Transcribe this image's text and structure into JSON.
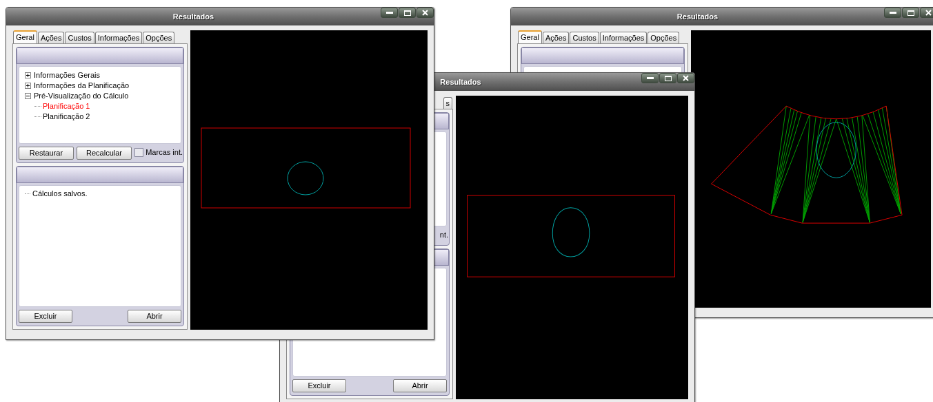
{
  "windows": [
    {
      "title": "Resultados",
      "tabs": [
        {
          "label": "Geral",
          "selected": true
        },
        {
          "label": "Ações",
          "selected": false
        },
        {
          "label": "Custos",
          "selected": false
        },
        {
          "label": "Informações",
          "selected": false
        },
        {
          "label": "Opções",
          "selected": false
        }
      ],
      "preview": {
        "kind": "fan"
      }
    },
    {
      "title": "Resultados",
      "tabs": [
        {
          "label": "s",
          "selected": false
        }
      ],
      "checkbox": {
        "label": "nt."
      },
      "list_buttons": [
        "Excluir",
        "Abrir"
      ],
      "preview": {
        "kind": "rectangle-oval"
      }
    },
    {
      "title": "Resultados",
      "tabs": [
        {
          "label": "Geral",
          "selected": true
        },
        {
          "label": "Ações",
          "selected": false
        },
        {
          "label": "Custos",
          "selected": false
        },
        {
          "label": "Informações",
          "selected": false
        },
        {
          "label": "Opções",
          "selected": false
        }
      ],
      "tree": [
        {
          "label": "Informações Gerais",
          "expanded": false,
          "selected": false
        },
        {
          "label": "Informações da Planificação",
          "expanded": false,
          "selected": false
        },
        {
          "label": "Pré-Visualização do Cálculo",
          "expanded": true,
          "selected": false,
          "children": [
            {
              "label": "Planificação 1",
              "selected": true
            },
            {
              "label": "Planificação 2",
              "selected": false
            }
          ]
        }
      ],
      "tree_buttons": [
        "Restaurar",
        "Recalcular"
      ],
      "checkbox": {
        "label": "Marcas int.",
        "checked": false
      },
      "saved_list": [
        "Cálculos salvos."
      ],
      "list_buttons": [
        "Excluir",
        "Abrir"
      ],
      "preview": {
        "kind": "rectangle-circle"
      }
    }
  ]
}
